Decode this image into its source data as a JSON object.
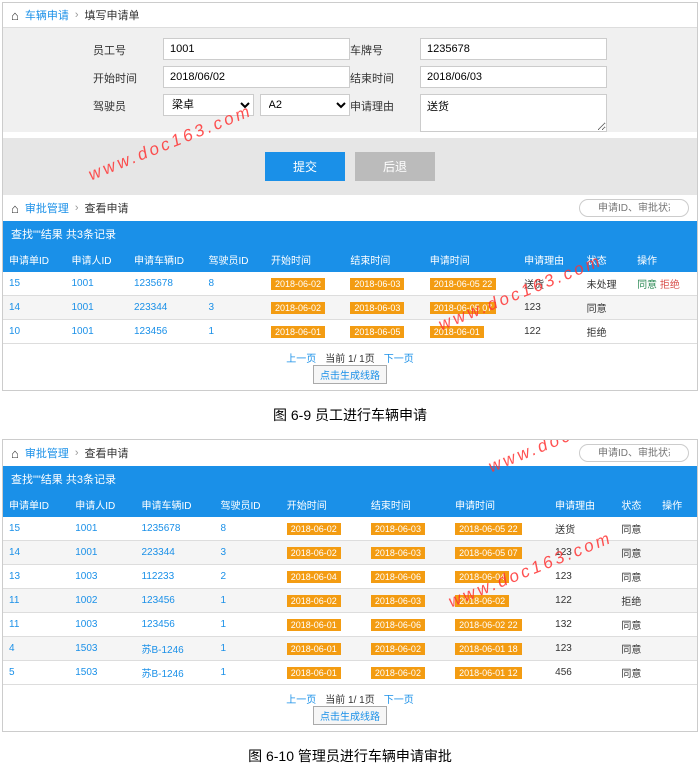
{
  "bc1": {
    "a": "车辆申请",
    "b": "填写申请单"
  },
  "form": {
    "l_emp": "员工号",
    "v_emp": "1001",
    "l_plate": "车牌号",
    "v_plate": "1235678",
    "l_start": "开始时间",
    "v_start": "2018/06/02",
    "l_end": "结束时间",
    "v_end": "2018/06/03",
    "l_driver": "驾驶员",
    "v_driver1": "梁卓",
    "v_driver2": "A2",
    "l_reason": "申请理由",
    "v_reason": "送货",
    "btn_submit": "提交",
    "btn_cancel": "后退"
  },
  "bc2": {
    "a": "审批管理",
    "b": "查看申请",
    "search_ph": "申请ID、审批状态"
  },
  "result_hdr1": "查找\"\"结果 共3条记录",
  "th": [
    "申请单ID",
    "申请人ID",
    "申请车辆ID",
    "驾驶员ID",
    "开始时间",
    "结束时间",
    "申请时间",
    "申请理由",
    "状态",
    "操作"
  ],
  "rows1": [
    {
      "id": "15",
      "aid": "1001",
      "cid": "1235678",
      "did": "8",
      "st": "2018-06-02",
      "et": "2018-06-03",
      "at": "2018-06-05 22",
      "rs": "送货",
      "sta": "未处理",
      "ops": true
    },
    {
      "id": "14",
      "aid": "1001",
      "cid": "223344",
      "did": "3",
      "st": "2018-06-02",
      "et": "2018-06-03",
      "at": "2018-06-05 07",
      "rs": "123",
      "sta": "同意",
      "ops": false
    },
    {
      "id": "10",
      "aid": "1001",
      "cid": "123456",
      "did": "1",
      "st": "2018-06-01",
      "et": "2018-06-05",
      "at": "2018-06-01",
      "rs": "122",
      "sta": "拒绝",
      "ops": false
    }
  ],
  "pager": {
    "prev": "上一页",
    "cur": "当前 1/ 1页",
    "next": "下一页",
    "btn": "点击生成线路"
  },
  "cap1": "图 6-9 员工进行车辆申请",
  "bc3": {
    "a": "审批管理",
    "b": "查看申请"
  },
  "result_hdr2": "查找\"\"结果 共3条记录",
  "rows2": [
    {
      "id": "15",
      "aid": "1001",
      "cid": "1235678",
      "did": "8",
      "st": "2018-06-02",
      "et": "2018-06-03",
      "at": "2018-06-05 22",
      "rs": "送货",
      "sta": "同意"
    },
    {
      "id": "14",
      "aid": "1001",
      "cid": "223344",
      "did": "3",
      "st": "2018-06-02",
      "et": "2018-06-03",
      "at": "2018-06-05 07",
      "rs": "123",
      "sta": "同意"
    },
    {
      "id": "13",
      "aid": "1003",
      "cid": "112233",
      "did": "2",
      "st": "2018-06-04",
      "et": "2018-06-06",
      "at": "2018-06-04",
      "rs": "123",
      "sta": "同意"
    },
    {
      "id": "11",
      "aid": "1002",
      "cid": "123456",
      "did": "1",
      "st": "2018-06-02",
      "et": "2018-06-03",
      "at": "2018-06-02",
      "rs": "122",
      "sta": "拒绝"
    },
    {
      "id": "11",
      "aid": "1003",
      "cid": "123456",
      "did": "1",
      "st": "2018-06-01",
      "et": "2018-06-06",
      "at": "2018-06-02 22",
      "rs": "132",
      "sta": "同意"
    },
    {
      "id": "4",
      "aid": "1503",
      "cid": "苏B-1246",
      "did": "1",
      "st": "2018-06-01",
      "et": "2018-06-02",
      "at": "2018-06-01 18",
      "rs": "123",
      "sta": "同意"
    },
    {
      "id": "5",
      "aid": "1503",
      "cid": "苏B-1246",
      "did": "1",
      "st": "2018-06-01",
      "et": "2018-06-02",
      "at": "2018-06-01 12",
      "rs": "456",
      "sta": "同意"
    }
  ],
  "cap2": "图 6-10 管理员进行车辆申请审批",
  "op_agree": "同意",
  "op_reject": "拒绝",
  "wm": "www.doc163.com"
}
